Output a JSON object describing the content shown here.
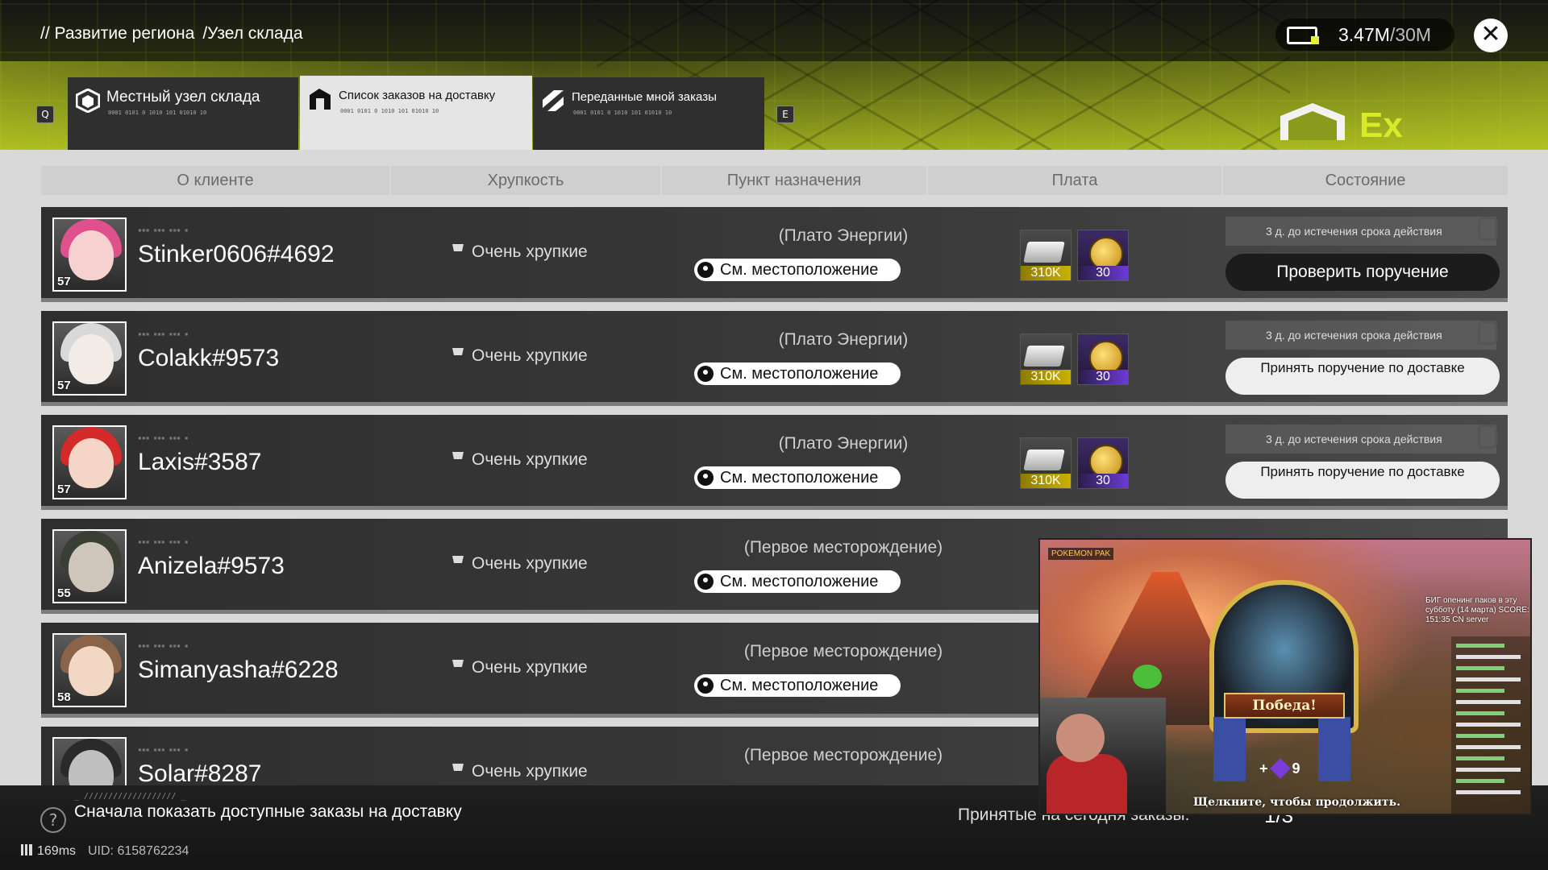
{
  "header": {
    "breadcrumb": [
      "// Развитие региона",
      "/Узел склада"
    ],
    "currency": {
      "value": "3.47M",
      "max": "/30M",
      "icon": "terminal-credit-icon"
    },
    "close_icon": "close-icon",
    "logo_text": "Ex",
    "accent_color": "#d8ea2a"
  },
  "tabs": [
    {
      "label": "Местный узел склада",
      "code": "0001 0101 0 1010 101 01010 10",
      "icon": "warehouse-icon",
      "active": false
    },
    {
      "label": "Список заказов на доставку",
      "code": "0001 0101 0 1010 101 01010 10",
      "icon": "order-list-icon",
      "active": true
    },
    {
      "label": "Переданные мной заказы",
      "code": "0001 0101 0 1010 101 01010 10",
      "icon": "sent-orders-icon",
      "active": false
    }
  ],
  "keycaps": {
    "left": "Q",
    "right": "E"
  },
  "columns": [
    "О клиенте",
    "Хрупкость",
    "Пункт назначения",
    "Плата",
    "Состояние"
  ],
  "rows": [
    {
      "name": "Stinker0606#4692",
      "level": "57",
      "fragility": "Очень хрупкие",
      "destination": "(Плато Энергии)",
      "location_label": "См. местоположение",
      "reward_silver": "310K",
      "reward_gold": "30",
      "expiry": "3 д. до истечения срока действия",
      "action": "Проверить поручение",
      "action_style": "dark",
      "avatar_hair": "#e0508c",
      "avatar_face": "#f6d1d0"
    },
    {
      "name": "Colakk#9573",
      "level": "57",
      "fragility": "Очень хрупкие",
      "destination": "(Плато Энергии)",
      "location_label": "См. местоположение",
      "reward_silver": "310K",
      "reward_gold": "30",
      "expiry": "3 д. до истечения срока действия",
      "action": "Принять поручение по доставке",
      "action_style": "light",
      "avatar_hair": "#d9d9d9",
      "avatar_face": "#f3ece6"
    },
    {
      "name": "Laxis#3587",
      "level": "57",
      "fragility": "Очень хрупкие",
      "destination": "(Плато Энергии)",
      "location_label": "См. местоположение",
      "reward_silver": "310K",
      "reward_gold": "30",
      "expiry": "3 д. до истечения срока действия",
      "action": "Принять поручение по доставке",
      "action_style": "light",
      "avatar_hair": "#d42a2a",
      "avatar_face": "#f5d5c8"
    },
    {
      "name": "Anizela#9573",
      "level": "55",
      "fragility": "Очень хрупкие",
      "destination": "(Первое месторождение)",
      "location_label": "См. местоположение",
      "avatar_hair": "#3a3f36",
      "avatar_face": "#cfc6bb"
    },
    {
      "name": "Simanyasha#6228",
      "level": "58",
      "fragility": "Очень хрупкие",
      "destination": "(Первое месторождение)",
      "location_label": "См. местоположение",
      "avatar_hair": "#8a6448",
      "avatar_face": "#f2d7c4"
    },
    {
      "name": "Solar#8287",
      "fragility": "Очень хрупкие",
      "destination": "(Первое месторождение)",
      "avatar_hair": "#2a2a2a",
      "avatar_face": "#bfbfbf"
    }
  ],
  "footer": {
    "hint_code": "_ /////////////////// _",
    "hint": "Сначала показать доступные заказы на доставку",
    "ping": "169ms",
    "uid": "UID: 6158762234",
    "accepted_label": "Принятые на сегодня заказы:",
    "accepted_count": "1/3"
  },
  "stream_overlay": {
    "pack_label": "POKEMON PAK",
    "victory": "Победа!",
    "gems": "9",
    "continue_text": "Щелкните, чтобы продолжить.",
    "info_text": "БИГ опенинг паков в эту субботу (14 марта) SCORE: 151:35 CN server"
  }
}
